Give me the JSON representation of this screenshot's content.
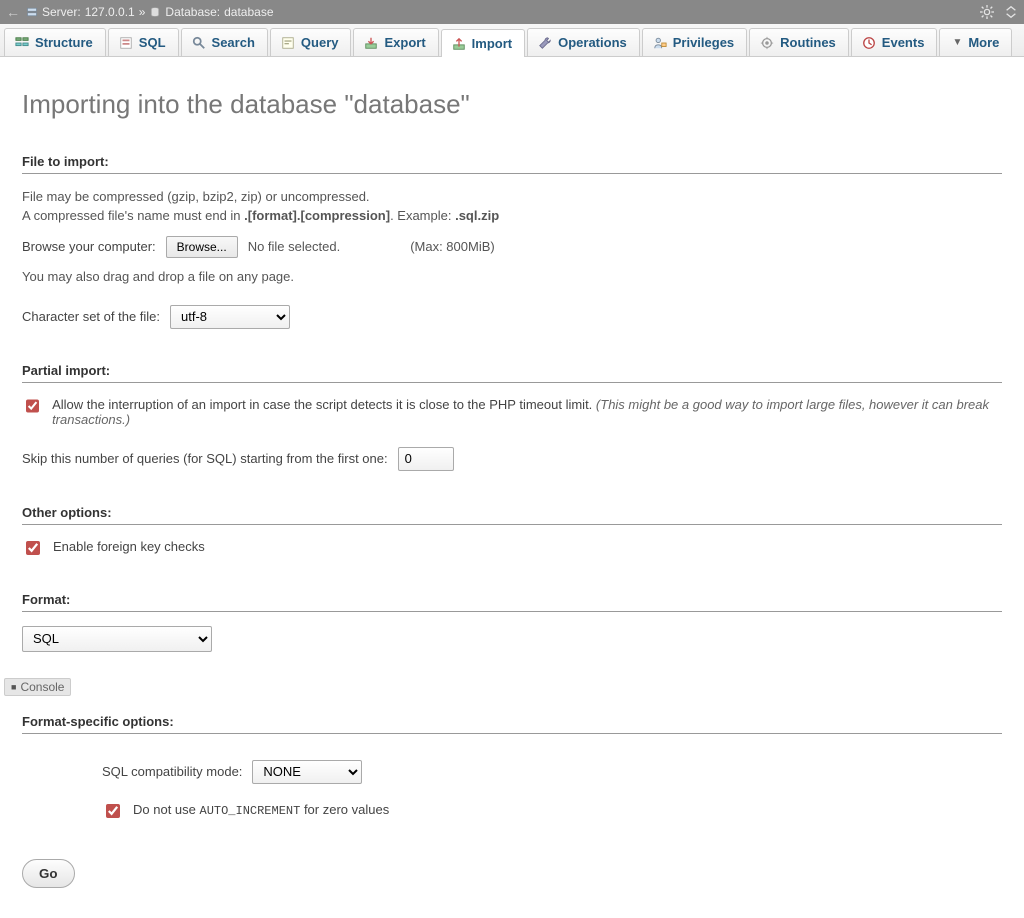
{
  "breadcrumb": {
    "server_label": "Server:",
    "server_value": "127.0.0.1",
    "separator": "»",
    "db_label": "Database:",
    "db_value": "database"
  },
  "tabs": [
    {
      "label": "Structure",
      "icon": "structure"
    },
    {
      "label": "SQL",
      "icon": "sql"
    },
    {
      "label": "Search",
      "icon": "search"
    },
    {
      "label": "Query",
      "icon": "query"
    },
    {
      "label": "Export",
      "icon": "export"
    },
    {
      "label": "Import",
      "icon": "import",
      "active": true
    },
    {
      "label": "Operations",
      "icon": "wrench"
    },
    {
      "label": "Privileges",
      "icon": "privileges"
    },
    {
      "label": "Routines",
      "icon": "routines"
    },
    {
      "label": "Events",
      "icon": "events"
    },
    {
      "label": "More",
      "icon": "more"
    }
  ],
  "title": "Importing into the database \"database\"",
  "file_section": {
    "heading": "File to import:",
    "line1": "File may be compressed (gzip, bzip2, zip) or uncompressed.",
    "line2_a": "A compressed file's name must end in ",
    "line2_bold1": ".[format].[compression]",
    "line2_b": ". Example: ",
    "line2_bold2": ".sql.zip",
    "browse_label": "Browse your computer:",
    "browse_button": "Browse...",
    "no_file": "No file selected.",
    "max": "(Max: 800MiB)",
    "dragdrop": "You may also drag and drop a file on any page.",
    "charset_label": "Character set of the file:",
    "charset_value": "utf-8"
  },
  "partial_section": {
    "heading": "Partial import:",
    "allow_label": "Allow the interruption of an import in case the script detects it is close to the PHP timeout limit.",
    "allow_note": "(This might be a good way to import large files, however it can break transactions.)",
    "skip_label": "Skip this number of queries (for SQL) starting from the first one:",
    "skip_value": "0"
  },
  "other_section": {
    "heading": "Other options:",
    "fk_label": "Enable foreign key checks"
  },
  "format_section": {
    "heading": "Format:",
    "value": "SQL"
  },
  "console_label": "Console",
  "fso_section": {
    "heading": "Format-specific options:",
    "compat_label": "SQL compatibility mode:",
    "compat_value": "NONE",
    "auto_inc_a": "Do not use ",
    "auto_inc_code": "AUTO_INCREMENT",
    "auto_inc_b": " for zero values"
  },
  "go_button": "Go"
}
